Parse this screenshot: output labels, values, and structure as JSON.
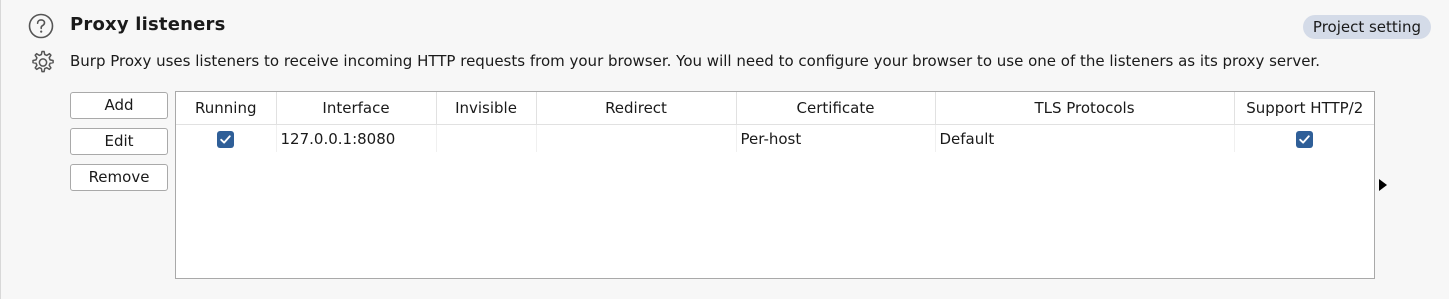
{
  "section": {
    "title": "Proxy listeners",
    "badge": "Project setting",
    "description": "Burp Proxy uses listeners to receive incoming HTTP requests from your browser. You will need to configure your browser to use one of the listeners as its proxy server.",
    "icons": {
      "help": "help-circle-icon",
      "settings": "gear-icon"
    }
  },
  "buttons": {
    "add": "Add",
    "edit": "Edit",
    "remove": "Remove"
  },
  "table": {
    "columns": [
      "Running",
      "Interface",
      "Invisible",
      "Redirect",
      "Certificate",
      "TLS Protocols",
      "Support HTTP/2"
    ],
    "rows": [
      {
        "running": true,
        "interface": "127.0.0.1:8080",
        "invisible": "",
        "redirect": "",
        "certificate": "Per-host",
        "tls_protocols": "Default",
        "support_http2": true
      }
    ]
  },
  "colors": {
    "accent": "#2f5f98",
    "badge_bg": "#d4dbe8"
  }
}
